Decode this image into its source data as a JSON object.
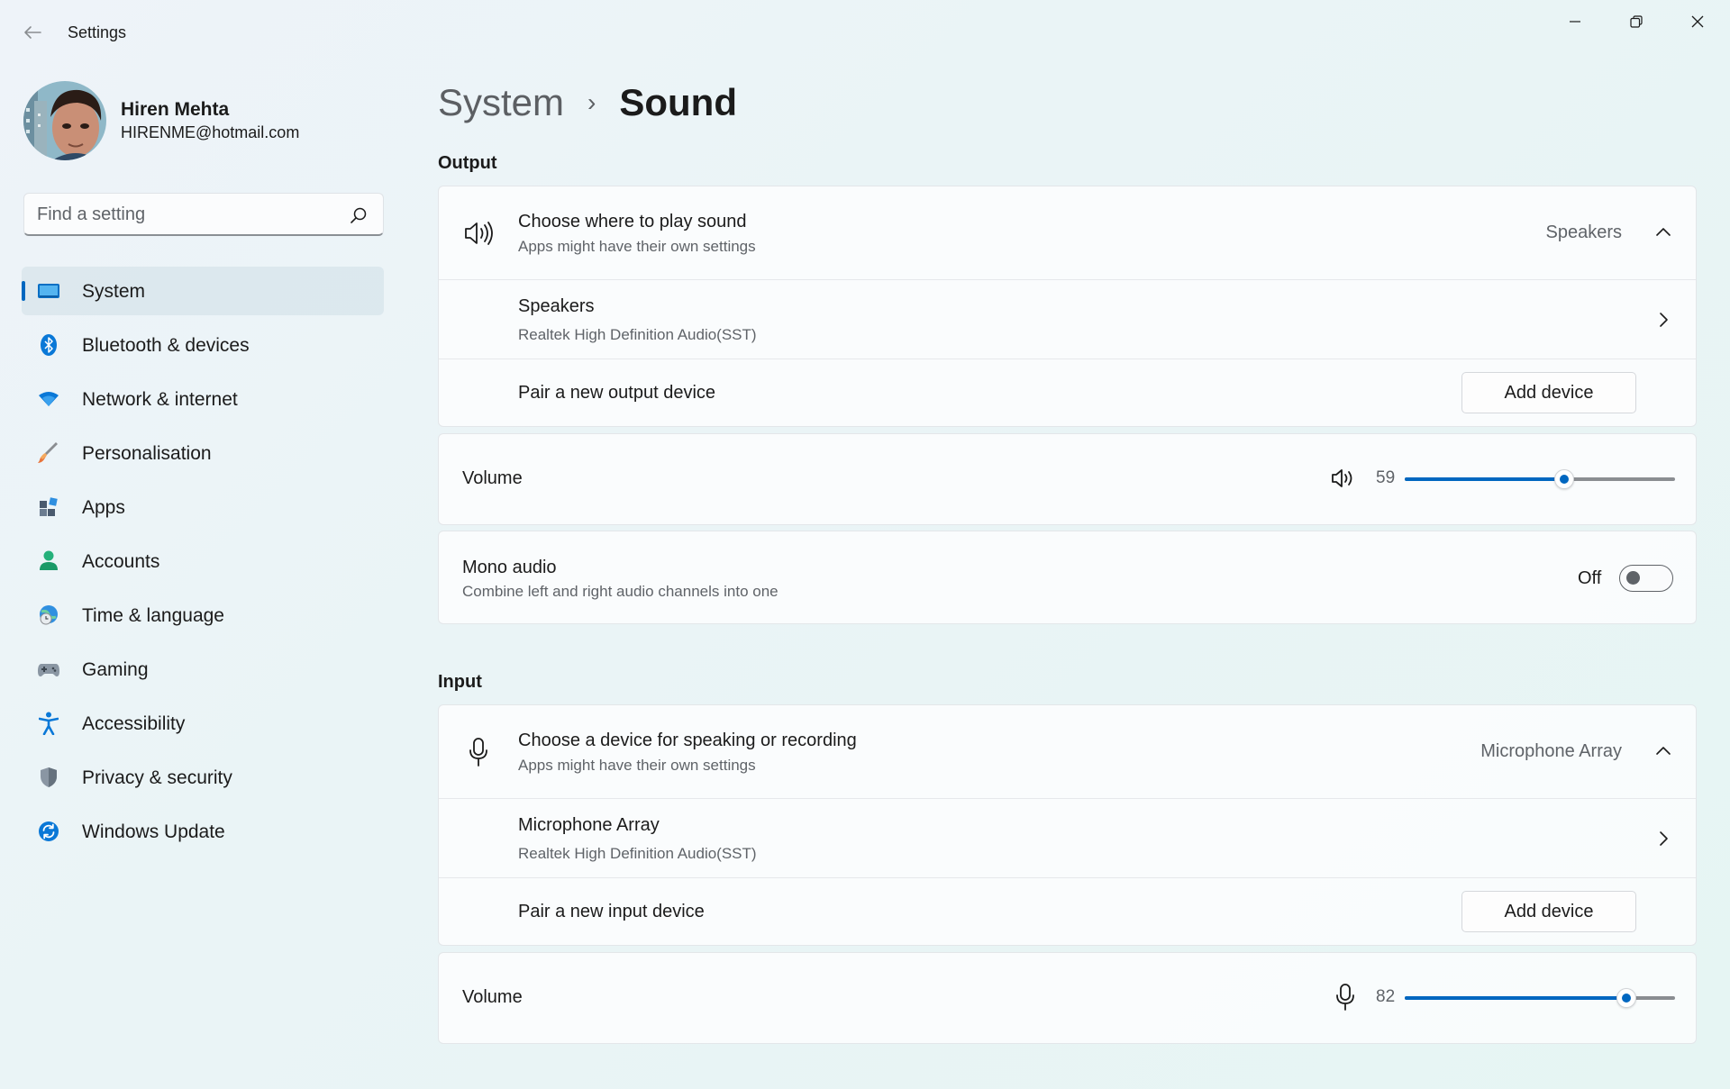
{
  "window": {
    "title": "Settings"
  },
  "profile": {
    "name": "Hiren Mehta",
    "email": "HIRENME@hotmail.com"
  },
  "search": {
    "placeholder": "Find a setting"
  },
  "nav": {
    "items": [
      {
        "label": "System",
        "icon": "system-icon",
        "active": true
      },
      {
        "label": "Bluetooth & devices",
        "icon": "bluetooth-icon"
      },
      {
        "label": "Network & internet",
        "icon": "wifi-icon"
      },
      {
        "label": "Personalisation",
        "icon": "brush-icon"
      },
      {
        "label": "Apps",
        "icon": "apps-icon"
      },
      {
        "label": "Accounts",
        "icon": "accounts-icon"
      },
      {
        "label": "Time & language",
        "icon": "globe-clock-icon"
      },
      {
        "label": "Gaming",
        "icon": "gamepad-icon"
      },
      {
        "label": "Accessibility",
        "icon": "accessibility-icon"
      },
      {
        "label": "Privacy & security",
        "icon": "shield-icon"
      },
      {
        "label": "Windows Update",
        "icon": "update-icon"
      }
    ]
  },
  "breadcrumb": {
    "parent": "System",
    "separator": "›",
    "current": "Sound"
  },
  "output": {
    "section_title": "Output",
    "choose": {
      "title": "Choose where to play sound",
      "subtitle": "Apps might have their own settings",
      "value": "Speakers"
    },
    "device": {
      "title": "Speakers",
      "subtitle": "Realtek High Definition Audio(SST)"
    },
    "pair": {
      "title": "Pair a new output device",
      "button": "Add device"
    },
    "volume": {
      "label": "Volume",
      "value": "59",
      "level": 59
    },
    "mono": {
      "title": "Mono audio",
      "subtitle": "Combine left and right audio channels into one",
      "state": "Off"
    }
  },
  "input": {
    "section_title": "Input",
    "choose": {
      "title": "Choose a device for speaking or recording",
      "subtitle": "Apps might have their own settings",
      "value": "Microphone Array"
    },
    "device": {
      "title": "Microphone Array",
      "subtitle": "Realtek High Definition Audio(SST)"
    },
    "pair": {
      "title": "Pair a new input device",
      "button": "Add device"
    },
    "volume": {
      "label": "Volume",
      "value": "82",
      "level": 82
    }
  },
  "colors": {
    "accent": "#0067c0"
  }
}
